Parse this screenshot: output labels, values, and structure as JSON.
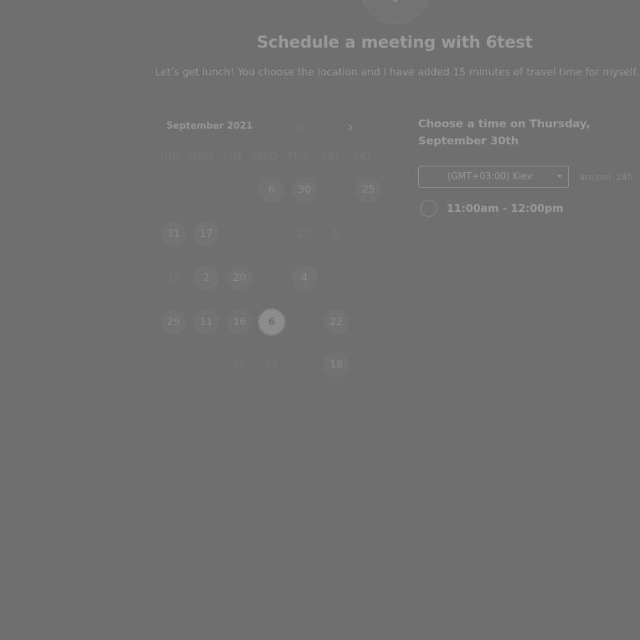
{
  "header": {
    "title": "Schedule a meeting with 6test",
    "description": "Let’s get lunch! You choose the location and I have added 15 minutes of travel time for myself."
  },
  "calendar": {
    "month_label": "September 2021",
    "prev_icon": "chevron-left-icon",
    "next_icon": "chevron-right-icon",
    "weekdays": [
      "SUN",
      "MON",
      "TUE",
      "WED",
      "THU",
      "FRI",
      "SAT"
    ],
    "weeks": [
      [
        {
          "label": "",
          "state": "empty"
        },
        {
          "label": "",
          "state": "empty"
        },
        {
          "label": "",
          "state": "empty"
        },
        {
          "label": "6",
          "state": "available"
        },
        {
          "label": "30",
          "state": "available"
        },
        {
          "label": "",
          "state": "empty"
        },
        {
          "label": "25",
          "state": "available"
        }
      ],
      [
        {
          "label": "31",
          "state": "available"
        },
        {
          "label": "17",
          "state": "available"
        },
        {
          "label": "",
          "state": "empty"
        },
        {
          "label": "",
          "state": "empty"
        },
        {
          "label": "12",
          "state": "dim"
        },
        {
          "label": "5",
          "state": "dim"
        },
        {
          "label": "",
          "state": "empty"
        }
      ],
      [
        {
          "label": "12",
          "state": "dim"
        },
        {
          "label": "2",
          "state": "available"
        },
        {
          "label": "20",
          "state": "available"
        },
        {
          "label": "",
          "state": "empty"
        },
        {
          "label": "4",
          "state": "available"
        },
        {
          "label": "",
          "state": "empty"
        },
        {
          "label": "",
          "state": "empty"
        }
      ],
      [
        {
          "label": "29",
          "state": "available"
        },
        {
          "label": "11",
          "state": "available"
        },
        {
          "label": "16",
          "state": "available"
        },
        {
          "label": "6",
          "state": "selected"
        },
        {
          "label": "",
          "state": "empty"
        },
        {
          "label": "22",
          "state": "available"
        },
        {
          "label": "",
          "state": "empty"
        }
      ],
      [
        {
          "label": "",
          "state": "empty"
        },
        {
          "label": "",
          "state": "empty"
        },
        {
          "label": "12",
          "state": "dim"
        },
        {
          "label": "19",
          "state": "dim"
        },
        {
          "label": "",
          "state": "empty"
        },
        {
          "label": "18",
          "state": "available"
        },
        {
          "label": "",
          "state": "empty"
        }
      ]
    ]
  },
  "times": {
    "heading": "Choose a time on Thursday, September 30th",
    "timezone": "(GMT+03:00) Kiev",
    "format_ampm": "am/pm",
    "format_24h": "24h",
    "slots": [
      {
        "label": "11:00am - 12:00pm"
      }
    ]
  },
  "colors": {
    "overlay": "#6f6f6f",
    "text_primary": "#999999"
  }
}
